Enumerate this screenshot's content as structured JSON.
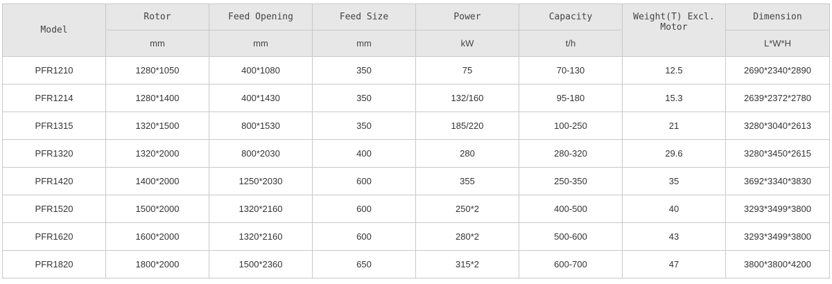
{
  "header": {
    "model": "Model",
    "rotor": "Rotor",
    "feed_opening": "Feed Opening",
    "feed_size": "Feed Size",
    "power": "Power",
    "capacity": "Capacity",
    "weight": "Weight(T)  Excl. Motor",
    "dimension": "Dimension"
  },
  "units": {
    "rotor": "mm",
    "feed_opening": "mm",
    "feed_size": "mm",
    "power": "kW",
    "capacity": "t/h",
    "dimension": "L*W*H"
  },
  "rows": [
    [
      "PFR1210",
      "1280*1050",
      "400*1080",
      "350",
      "75",
      "70-130",
      "12.5",
      "2690*2340*2890"
    ],
    [
      "PFR1214",
      "1280*1400",
      "400*1430",
      "350",
      "132/160",
      "95-180",
      "15.3",
      "2639*2372*2780"
    ],
    [
      "PFR1315",
      "1320*1500",
      "800*1530",
      "350",
      "185/220",
      "100-250",
      "21",
      "3280*3040*2613"
    ],
    [
      "PFR1320",
      "1320*2000",
      "800*2030",
      "400",
      "280",
      "280-320",
      "29.6",
      "3280*3450*2615"
    ],
    [
      "PFR1420",
      "1400*2000",
      "1250*2030",
      "600",
      "355",
      "250-350",
      "35",
      "3692*3340*3830"
    ],
    [
      "PFR1520",
      "1500*2000",
      "1320*2160",
      "600",
      "250*2",
      "400-500",
      "40",
      "3293*3499*3800"
    ],
    [
      "PFR1620",
      "1600*2000",
      "1320*2160",
      "600",
      "280*2",
      "500-600",
      "43",
      "3293*3499*3800"
    ],
    [
      "PFR1820",
      "1800*2000",
      "1500*2360",
      "650",
      "315*2",
      "600-700",
      "47",
      "3800*3800*4200"
    ]
  ]
}
